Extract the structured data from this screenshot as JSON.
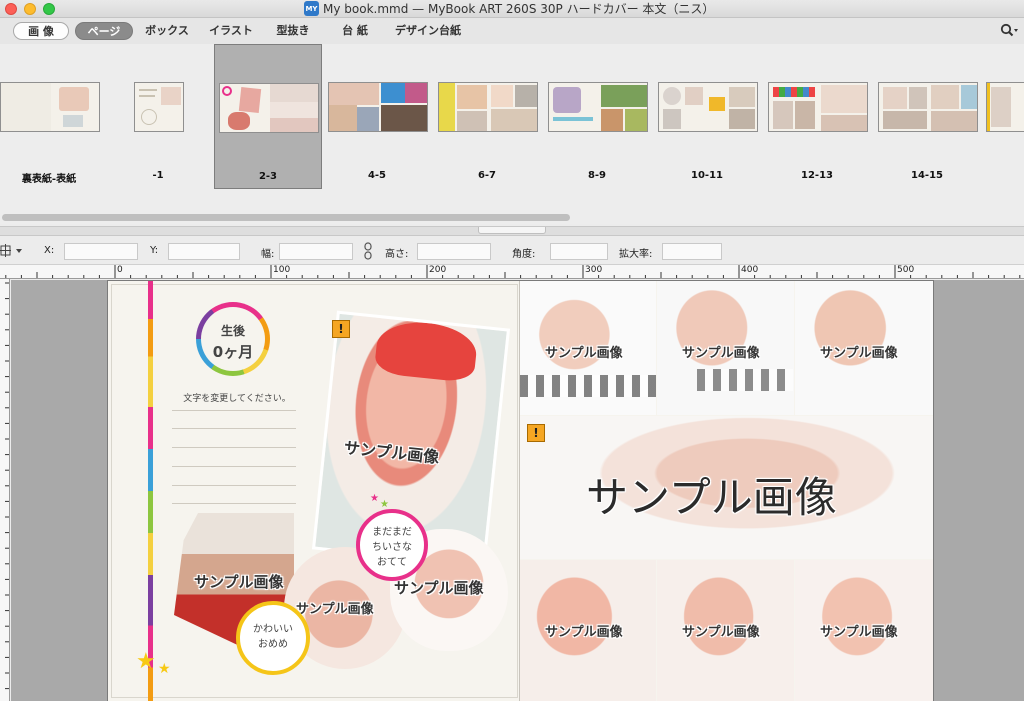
{
  "window": {
    "title": "My book.mmd — MyBook ART 260S 30P ハードカバー 本文（ニス）",
    "app_icon": "MY"
  },
  "tabs": [
    {
      "label": "画 像",
      "active": false
    },
    {
      "label": "ページ",
      "active": true
    },
    {
      "label": "ボックス",
      "active": false
    },
    {
      "label": "イラスト",
      "active": false
    },
    {
      "label": "型抜き",
      "active": false
    },
    {
      "label": "台 紙",
      "active": false
    },
    {
      "label": "デザイン台紙",
      "active": false
    }
  ],
  "page_strip": {
    "pages": [
      {
        "label": "裏表紙-表紙",
        "selected": false
      },
      {
        "label": "-1",
        "selected": false
      },
      {
        "label": "2-3",
        "selected": true
      },
      {
        "label": "4-5",
        "selected": false
      },
      {
        "label": "6-7",
        "selected": false
      },
      {
        "label": "8-9",
        "selected": false
      },
      {
        "label": "10-11",
        "selected": false
      },
      {
        "label": "12-13",
        "selected": false
      },
      {
        "label": "14-15",
        "selected": false
      }
    ]
  },
  "properties": {
    "x_label": "X:",
    "y_label": "Y:",
    "width_label": "幅:",
    "height_label": "高さ:",
    "angle_label": "角度:",
    "scale_label": "拡大率:",
    "x_value": "",
    "y_value": "",
    "width_value": "",
    "height_value": "",
    "angle_value": "",
    "scale_value": ""
  },
  "ruler": {
    "marks": [
      "0",
      "100",
      "200",
      "300",
      "400",
      "500"
    ]
  },
  "spread": {
    "badge_line1": "生後",
    "badge_line2": "0ヶ月",
    "caption_placeholder": "文字を変更してください。",
    "sample_label": "サンプル画像",
    "bubble_pink_lines": [
      "まだまだ",
      "ちいさな",
      "おてて"
    ],
    "bubble_yellow_lines": [
      "かわいい",
      "おめめ"
    ],
    "warning_symbol": "!"
  },
  "colors": {
    "selected_tab": "#8b8b8b",
    "selected_thumb": "#b0b0b0",
    "accent_pink": "#e8308a",
    "accent_yellow": "#f5c518",
    "warning": "#f5a623",
    "canvas_background": "#a9a9a9"
  }
}
